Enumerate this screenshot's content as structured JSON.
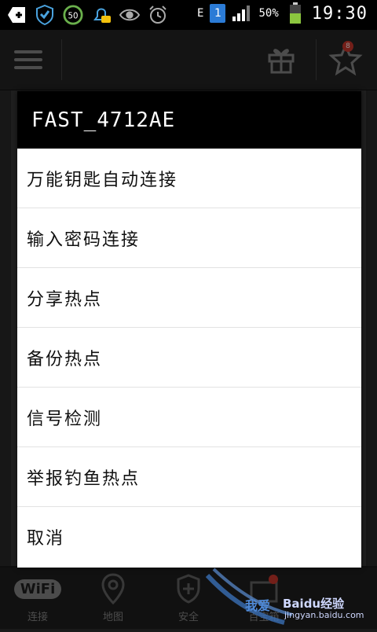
{
  "status_bar": {
    "network_type": "E",
    "sim_slot": "1",
    "badge_value": "50",
    "battery_percent": "50%",
    "time": "19:30"
  },
  "app_bar": {
    "gift_badge_count": "8"
  },
  "dialog": {
    "title": "FAST_4712AE",
    "options": [
      "万能钥匙自动连接",
      "输入密码连接",
      "分享热点",
      "备份热点",
      "信号检测",
      "举报钓鱼热点",
      "取消"
    ]
  },
  "bottom_nav": {
    "items": [
      {
        "label": "连接",
        "icon_text": "WiFi"
      },
      {
        "label": "地图"
      },
      {
        "label": "安全"
      },
      {
        "label": "百宝箱"
      }
    ]
  },
  "watermark": {
    "prefix": "我爱",
    "brand": "Baidu经验",
    "url": "jingyan.baidu.com"
  },
  "colors": {
    "status_bar": "#000000",
    "dialog_title_bg": "#000000",
    "dialog_body": "#ffffff",
    "badge": "#d23a2f"
  }
}
